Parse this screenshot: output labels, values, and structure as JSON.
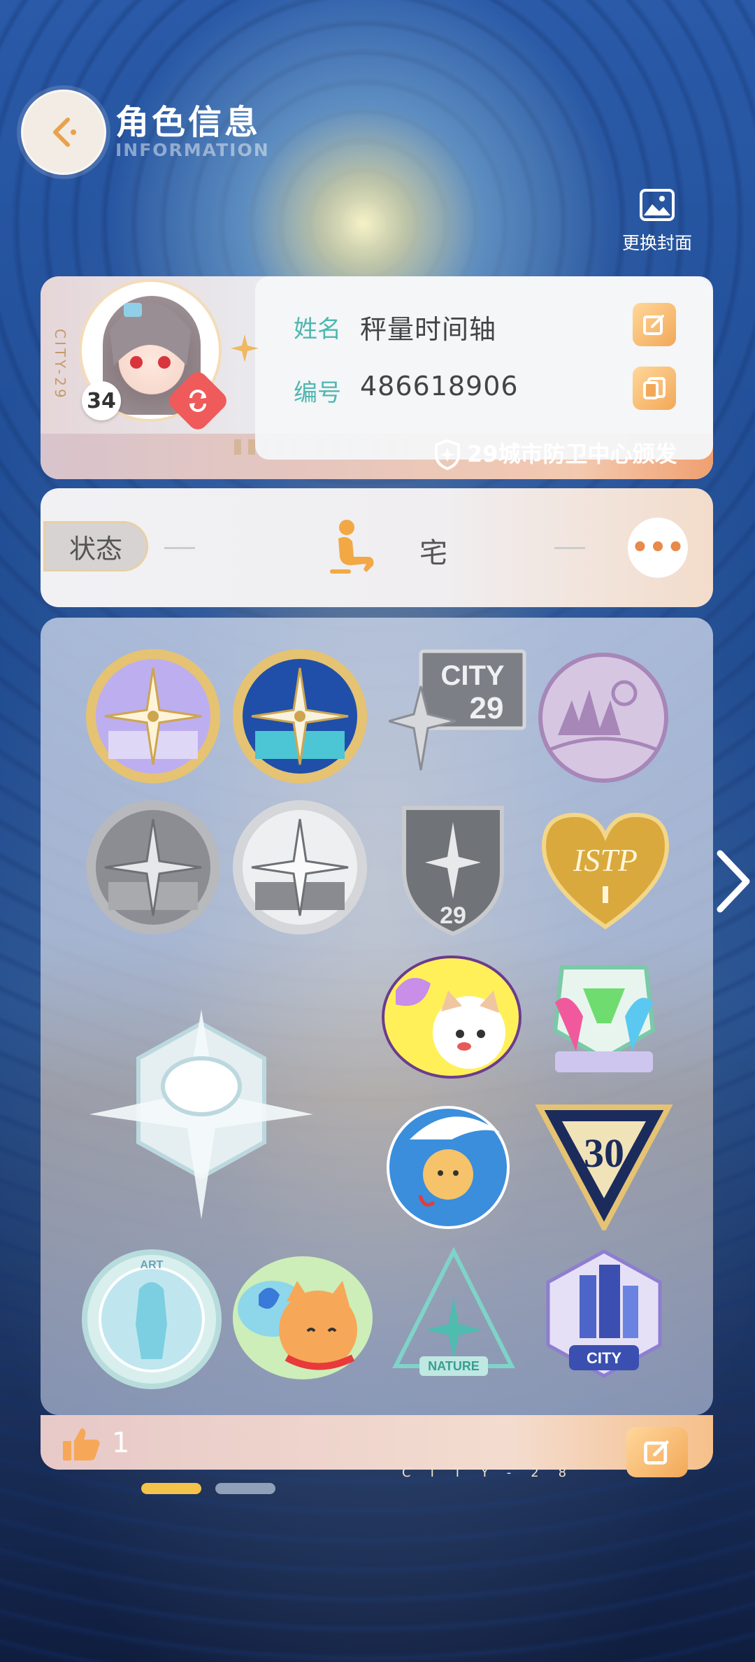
{
  "header": {
    "title": "角色信息",
    "subtitle": "INFORMATION",
    "cover_button": "更换封面"
  },
  "profile": {
    "level": "34",
    "city_tag": "CITY-29",
    "name_label": "姓名",
    "name_value": "秤量时间轴",
    "id_label": "编号",
    "id_value": "486618906",
    "issuer": "29城市防卫中心颁发"
  },
  "status": {
    "label": "状态",
    "value": "宅"
  },
  "badges": [
    {
      "name": "compass-badge-purple"
    },
    {
      "name": "compass-badge-blue"
    },
    {
      "name": "city-29-badge",
      "text": "CITY 29"
    },
    {
      "name": "forest-badge"
    },
    {
      "name": "compass-badge-silver-1"
    },
    {
      "name": "compass-badge-silver-2"
    },
    {
      "name": "shield-29-badge",
      "text": "29"
    },
    {
      "name": "istp-heart-badge",
      "text": "ISTP"
    },
    {
      "name": "star-hexagon-badge"
    },
    {
      "name": "cat-heart-badge"
    },
    {
      "name": "rainbow-hands-badge"
    },
    {
      "name": "rain-cat-badge"
    },
    {
      "name": "triangle-30-badge",
      "text": "30"
    },
    {
      "name": "art-statue-badge",
      "text": "ART"
    },
    {
      "name": "orange-cat-badge"
    },
    {
      "name": "nature-badge",
      "text": "NATURE"
    },
    {
      "name": "city-building-badge",
      "text": "CITY"
    }
  ],
  "footer": {
    "likes": "1",
    "city_text": "CITY-28"
  },
  "colors": {
    "accent_orange": "#f2a858",
    "teal_label": "#4fb7b0",
    "page_indicator_active": "#f3c34a"
  }
}
